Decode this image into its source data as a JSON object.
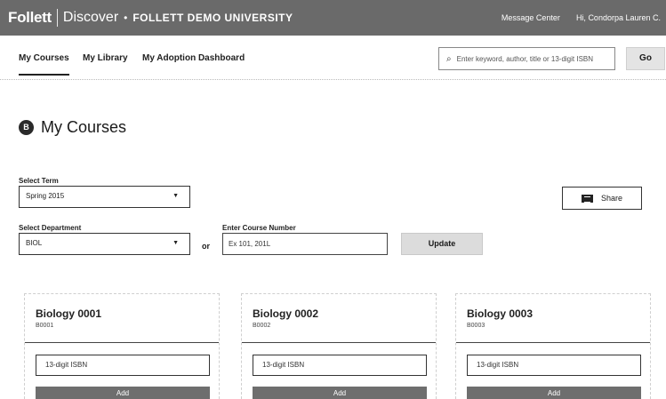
{
  "header": {
    "brand": "Follett",
    "product": "Discover",
    "dot": "•",
    "school": "FOLLETT DEMO UNIVERSITY",
    "message_center": "Message Center",
    "greeting": "Hi, Condorpa Lauren C."
  },
  "nav": {
    "tabs": [
      {
        "label": "My Courses",
        "active": true
      },
      {
        "label": "My Library",
        "active": false
      },
      {
        "label": "My Adoption Dashboard",
        "active": false
      }
    ],
    "search_placeholder": "Enter keyword, author, title or 13-digit ISBN",
    "go_label": "Go"
  },
  "page": {
    "title_icon": "B",
    "title": "My Courses"
  },
  "filters": {
    "term_label": "Select Term",
    "term_value": "Spring 2015",
    "department_label": "Select Department",
    "department_value": "BIOL",
    "or_label": "or",
    "course_number_label": "Enter Course Number",
    "course_number_placeholder": "Ex 101, 201L",
    "update_label": "Update",
    "share_label": "Share",
    "dropdown_arrow": "▼"
  },
  "courses": [
    {
      "title": "Biology 0001",
      "code": "B0001",
      "isbn_placeholder": "13-digit ISBN",
      "add_label": "Add"
    },
    {
      "title": "Biology 0002",
      "code": "B0002",
      "isbn_placeholder": "13-digit ISBN",
      "add_label": "Add"
    },
    {
      "title": "Biology 0003",
      "code": "B0003",
      "isbn_placeholder": "13-digit ISBN",
      "add_label": "Add"
    }
  ],
  "icons": {
    "search": "search-icon",
    "share": "share-icon",
    "title": "book-icon"
  },
  "colors": {
    "topbar": "#6a6a6a",
    "button": "#6e6e6e",
    "text": "#1a1a1a"
  }
}
